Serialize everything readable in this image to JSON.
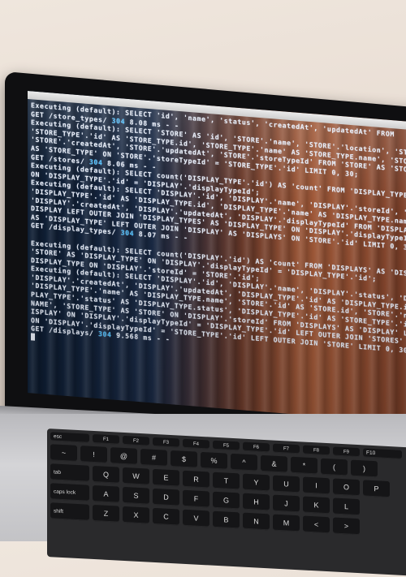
{
  "terminal": {
    "lines": [
      "Executing (default): SELECT 'id', 'name', 'status', 'createdAt', 'updatedAt' FROM",
      "GET /store_types/ 304 8.08 ms - -",
      "Executing (default): SELECT 'STORE' AS 'id', 'STORE'.'name', 'STORE'.'location', 'STORE'.'phone',",
      "'STORE_TYPE'.'id' AS 'STORE_TYPE.id', 'STORE_TYPE'.'name' AS 'STORE_TYPE.name', 'STORE'.'status',",
      "'STORE'.'createdAt', 'STORE'.'updatedAt', 'STORE'.'storeTypeId' FROM 'STORE' AS 'STORE' LEFT OUTER",
      "AS 'STORE_TYPE' ON 'STORE'.'storeTypeId' = 'STORE_TYPE'.'id' LIMIT 0, 30;",
      "GET /stores/ 304 8.06 ms - -",
      "Executing (default): SELECT count('DISPLAY_TYPE'.'id') AS 'count' FROM 'DISPLAY_TYPES' AS 'DISPLAY_TYPE'",
      "ON 'DISPLAY_TYPE'.'id' = 'DISPLAY'.'displayTypeId';",
      "Executing (default): SELECT 'DISPLAY'.'id', 'DISPLAY'.'name', 'DISPLAY'.'storeId', 'DISPLAY'.'status',",
      "'DISPLAY_TYPE'.'id' AS 'DISPLAY_TYPE.id', 'DISPLAY_TYPE'.'name' AS 'DISPLAY_TYPE.name',",
      "'DISPLAY'.'createdAt', 'DISPLAY'.'updatedAt', 'DISPLAY'.'displayTypeId' FROM 'DISPLAYS' AS",
      "DISPLAY LEFT OUTER JOIN 'DISPLAY_TYPES' AS 'DISPLAY_TYPE' ON 'DISPLAY'.'displayTypeId' = 'DISPLAY_TYPE'.'id'",
      "AS 'DISPLAY_TYPE' LEFT OUTER JOIN 'DISPLAY' AS 'DISPLAYS' ON 'STORE'.'id' LIMIT 0, 30;",
      "GET /display_types/ 304 8.07 ms - -",
      "",
      "Executing (default): SELECT count('DISPLAY'.'id') AS 'count' FROM 'DISPLAYS' AS 'DISPLAY' LEFT OUTER JOIN",
      "'STORE' AS 'DISPLAY_TYPE' ON 'DISPLAY'.'displayTypeId' = 'DISPLAY_TYPE'.'id';",
      "DISPLAY_TYPE ON 'DISPLAY'.'storeId' = 'STORE'.'id';",
      "Executing (default): SELECT 'DISPLAY'.'id', 'DISPLAY'.'name', 'DISPLAY'.'status', 'DISPLAY'.'storeId',",
      "'DISPLAY'.'createdAt', 'DISPLAY'.'updatedAt', 'DISPLAY_TYPE'.'id' AS 'DISPLAY_TYPE.id',",
      "'DISPLAY_TYPE'.'name' AS 'DISPLAY_TYPE.name', 'STORE'.'id' AS 'STORE.id', 'STORE'.'name',",
      "PLAY_TYPE'.'status' AS 'DISPLAY_TYPE.status', 'DISPLAY_TYPE'.'id' AS 'STORE_TYPE'.'id',",
      "NAME', 'STORE_TYPE' AS 'STORE' ON 'DISPLAY'.'storeId' FROM 'DISPLAYS' AS 'DISPLAY' LEFT OUTER JOIN",
      "ISPLAY' ON 'DISPLAY'.'displayTypeId' = 'DISPLAY_TYPE'.'id' LEFT OUTER JOIN 'STORES' AS",
      "ON 'DISPLAY'.'displayTypeId' = 'STORE_TYPE'.'id' LEFT OUTER JOIN 'STORE' LIMIT 0, 30;",
      "GET /displays/ 304 9.568 ms - -"
    ],
    "highlights": [
      "304"
    ]
  },
  "keyboard": {
    "fn_row": [
      "esc",
      "F1",
      "F2",
      "F3",
      "F4",
      "F5",
      "F6",
      "F7",
      "F8",
      "F9",
      "F10"
    ],
    "number_row": [
      "~",
      "!",
      "@",
      "#",
      "$",
      "%",
      "^",
      "&",
      "*",
      "(",
      ")"
    ],
    "top_row": [
      "tab",
      "Q",
      "W",
      "E",
      "R",
      "T",
      "Y",
      "U",
      "I",
      "O",
      "P"
    ],
    "home_row": [
      "caps lock",
      "A",
      "S",
      "D",
      "F",
      "G",
      "H",
      "J",
      "K",
      "L"
    ],
    "bottom_row": [
      "shift",
      "Z",
      "X",
      "C",
      "V",
      "B",
      "N",
      "M",
      "<",
      ">"
    ]
  }
}
